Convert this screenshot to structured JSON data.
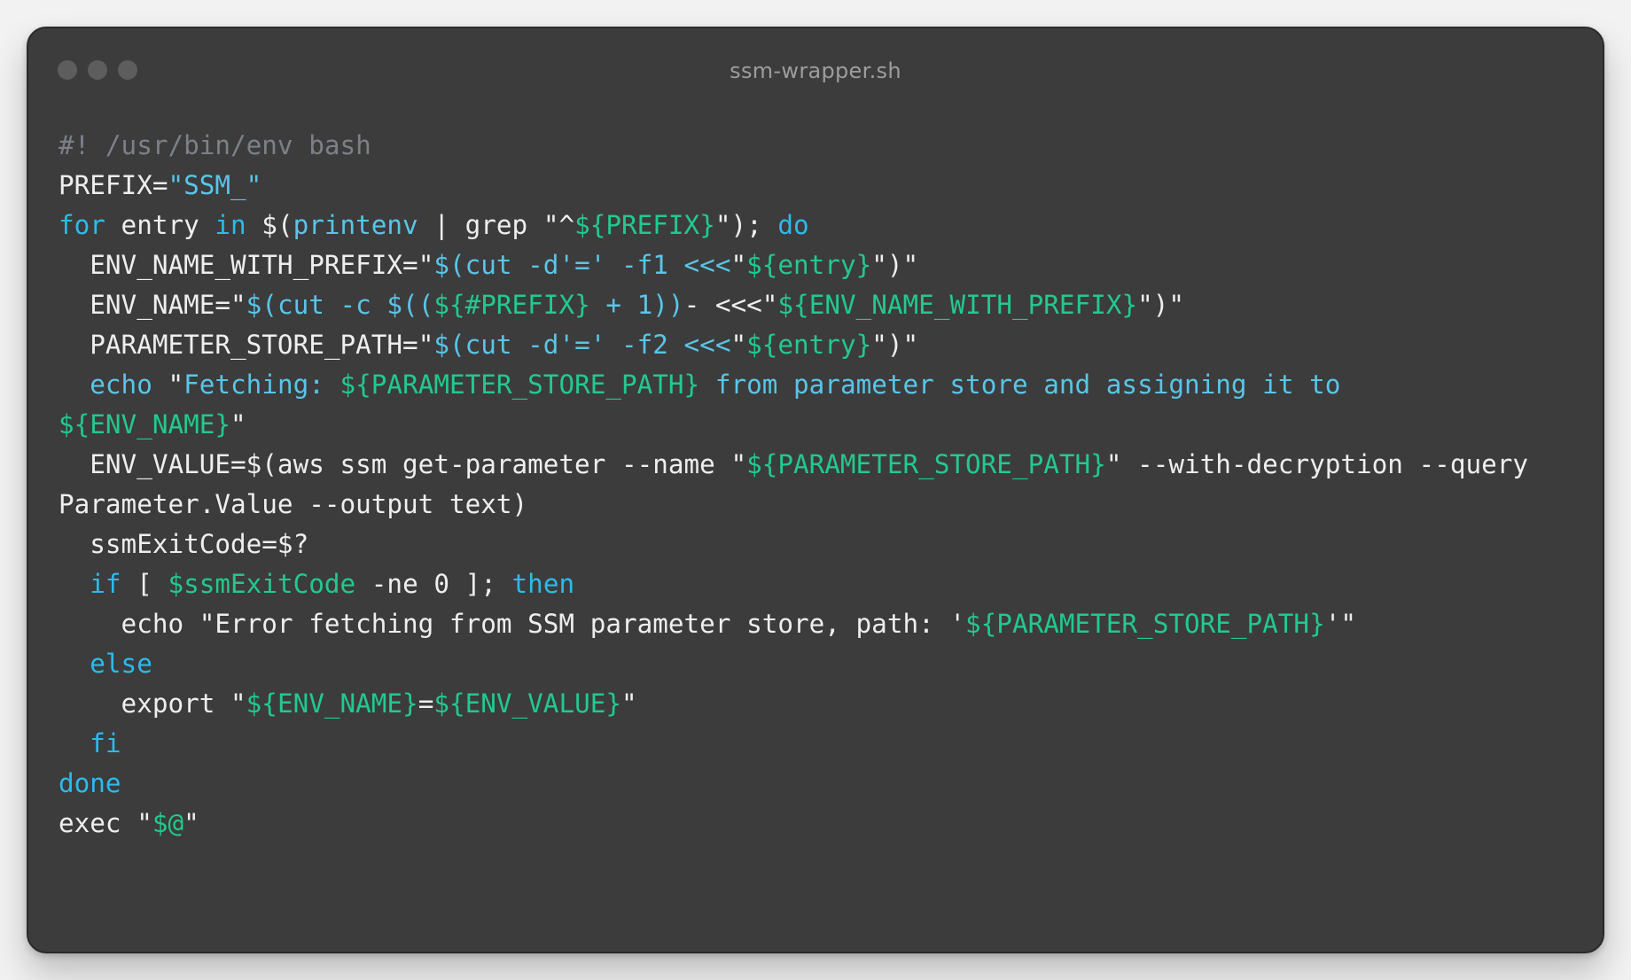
{
  "window": {
    "title": "ssm-wrapper.sh",
    "colors": {
      "background": "#3c3c3c",
      "traffic_light": "#5d5d5d",
      "title": "#9d9d9d"
    }
  },
  "code": {
    "colors": {
      "plain": "#eeeeee",
      "comment": "#7c8088",
      "keyword": "#2bbbec",
      "string": "#59c5e8",
      "var": "#22c98e"
    },
    "lines": [
      [
        {
          "t": "comment",
          "v": "#! /usr/bin/env bash"
        }
      ],
      [
        {
          "t": "plain",
          "v": "PREFIX="
        },
        {
          "t": "string",
          "v": "\"SSM_\""
        }
      ],
      [
        {
          "t": "keyword",
          "v": "for"
        },
        {
          "t": "plain",
          "v": " entry "
        },
        {
          "t": "keyword",
          "v": "in"
        },
        {
          "t": "plain",
          "v": " $("
        },
        {
          "t": "string",
          "v": "printenv"
        },
        {
          "t": "plain",
          "v": " | grep "
        },
        {
          "t": "plain",
          "v": "\"^"
        },
        {
          "t": "var",
          "v": "${PREFIX}"
        },
        {
          "t": "plain",
          "v": "\"); "
        },
        {
          "t": "keyword",
          "v": "do"
        }
      ],
      [
        {
          "t": "plain",
          "v": "  ENV_NAME_WITH_PREFIX="
        },
        {
          "t": "plain",
          "v": "\""
        },
        {
          "t": "string",
          "v": "$(cut -d'=' -f1 <<<"
        },
        {
          "t": "plain",
          "v": "\""
        },
        {
          "t": "var",
          "v": "${entry}"
        },
        {
          "t": "plain",
          "v": "\")\""
        }
      ],
      [
        {
          "t": "plain",
          "v": "  ENV_NAME="
        },
        {
          "t": "plain",
          "v": "\""
        },
        {
          "t": "string",
          "v": "$(cut -c $(("
        },
        {
          "t": "var",
          "v": "${#PREFIX}"
        },
        {
          "t": "string",
          "v": " + 1))"
        },
        {
          "t": "plain",
          "v": "- <<<\""
        },
        {
          "t": "var",
          "v": "${ENV_NAME_WITH_PREFIX}"
        },
        {
          "t": "plain",
          "v": "\")\""
        }
      ],
      [
        {
          "t": "plain",
          "v": "  PARAMETER_STORE_PATH="
        },
        {
          "t": "plain",
          "v": "\""
        },
        {
          "t": "string",
          "v": "$(cut -d'=' -f2 <<<"
        },
        {
          "t": "plain",
          "v": "\""
        },
        {
          "t": "var",
          "v": "${entry}"
        },
        {
          "t": "plain",
          "v": "\")\""
        }
      ],
      [
        {
          "t": "plain",
          "v": "  "
        },
        {
          "t": "string",
          "v": "echo"
        },
        {
          "t": "plain",
          "v": " \""
        },
        {
          "t": "string",
          "v": "Fetching: "
        },
        {
          "t": "var",
          "v": "${PARAMETER_STORE_PATH}"
        },
        {
          "t": "string",
          "v": " from parameter store and assigning it to"
        }
      ],
      [
        {
          "t": "var",
          "v": "${ENV_NAME}"
        },
        {
          "t": "plain",
          "v": "\""
        }
      ],
      [
        {
          "t": "plain",
          "v": "  ENV_VALUE=$(aws ssm get-parameter --name "
        },
        {
          "t": "plain",
          "v": "\""
        },
        {
          "t": "var",
          "v": "${PARAMETER_STORE_PATH}"
        },
        {
          "t": "plain",
          "v": "\" --with-decryption --query"
        }
      ],
      [
        {
          "t": "plain",
          "v": "Parameter.Value --output text)"
        }
      ],
      [
        {
          "t": "plain",
          "v": "  ssmExitCode=$?"
        }
      ],
      [
        {
          "t": "plain",
          "v": "  "
        },
        {
          "t": "keyword",
          "v": "if"
        },
        {
          "t": "plain",
          "v": " [ "
        },
        {
          "t": "var",
          "v": "$ssmExitCode"
        },
        {
          "t": "plain",
          "v": " -ne 0 ]; "
        },
        {
          "t": "keyword",
          "v": "then"
        }
      ],
      [
        {
          "t": "plain",
          "v": "    echo \"Error fetching from SSM parameter store, path: '"
        },
        {
          "t": "var",
          "v": "${PARAMETER_STORE_PATH}"
        },
        {
          "t": "plain",
          "v": "'\""
        }
      ],
      [
        {
          "t": "plain",
          "v": "  "
        },
        {
          "t": "keyword",
          "v": "else"
        }
      ],
      [
        {
          "t": "plain",
          "v": "    export \""
        },
        {
          "t": "var",
          "v": "${ENV_NAME}"
        },
        {
          "t": "plain",
          "v": "="
        },
        {
          "t": "var",
          "v": "${ENV_VALUE}"
        },
        {
          "t": "plain",
          "v": "\""
        }
      ],
      [
        {
          "t": "plain",
          "v": "  "
        },
        {
          "t": "keyword",
          "v": "fi"
        }
      ],
      [
        {
          "t": "keyword",
          "v": "done"
        }
      ],
      [
        {
          "t": "plain",
          "v": "exec \""
        },
        {
          "t": "var",
          "v": "$@"
        },
        {
          "t": "plain",
          "v": "\""
        }
      ]
    ]
  }
}
